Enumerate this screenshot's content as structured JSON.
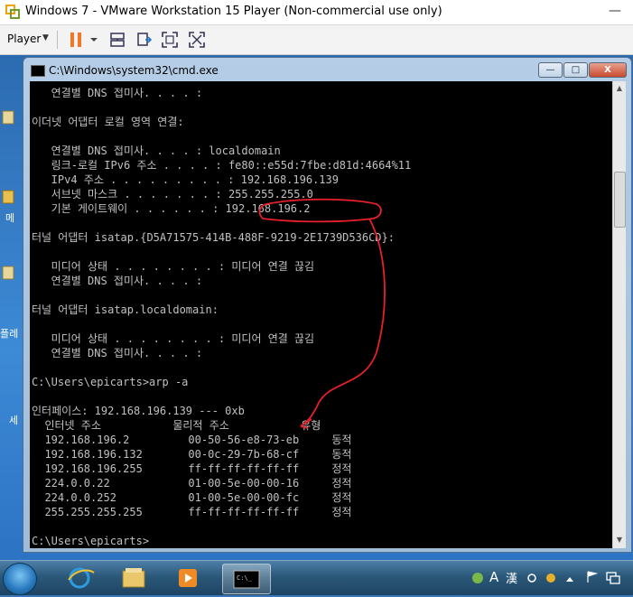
{
  "vmware": {
    "title": "Windows 7 - VMware Workstation 15 Player (Non-commercial use only)",
    "menu_label": "Player",
    "minimize_glyph": "—"
  },
  "cmd": {
    "title": "C:\\Windows\\system32\\cmd.exe",
    "min_glyph": "—",
    "max_glyph": "□",
    "close_glyph": "X"
  },
  "console_lines": [
    "   연결별 DNS 접미사. . . . :",
    "",
    "이더넷 어댑터 로컬 영역 연결:",
    "",
    "   연결별 DNS 접미사. . . . : localdomain",
    "   링크-로컬 IPv6 주소 . . . . : fe80::e55d:7fbe:d81d:4664%11",
    "   IPv4 주소 . . . . . . . . . : 192.168.196.139",
    "   서브넷 마스크 . . . . . . . : 255.255.255.0",
    "   기본 게이트웨이 . . . . . . : 192.168.196.2",
    "",
    "터널 어댑터 isatap.{D5A71575-414B-488F-9219-2E1739D536CD}:",
    "",
    "   미디어 상태 . . . . . . . . : 미디어 연결 끊김",
    "   연결별 DNS 접미사. . . . :",
    "",
    "터널 어댑터 isatap.localdomain:",
    "",
    "   미디어 상태 . . . . . . . . : 미디어 연결 끊김",
    "   연결별 DNS 접미사. . . . :",
    "",
    "C:\\Users\\epicarts>arp -a",
    "",
    "인터페이스: 192.168.196.139 --- 0xb",
    "  인터넷 주소           물리적 주소           유형",
    "  192.168.196.2         00-50-56-e8-73-eb     동적",
    "  192.168.196.132       00-0c-29-7b-68-cf     동적",
    "  192.168.196.255       ff-ff-ff-ff-ff-ff     정적",
    "  224.0.0.22            01-00-5e-00-00-16     정적",
    "  224.0.0.252           01-00-5e-00-00-fc     정적",
    "  255.255.255.255       ff-ff-ff-ff-ff-ff     정적",
    "",
    "C:\\Users\\epicarts>"
  ],
  "desktop": {
    "label_1": "메",
    "label_2": "플레",
    "label_3": "세"
  },
  "tray": {
    "lang": "A",
    "hanja": "漢"
  },
  "colors": {
    "annotation": "#e8202a",
    "console_text": "#c0c0c0"
  }
}
